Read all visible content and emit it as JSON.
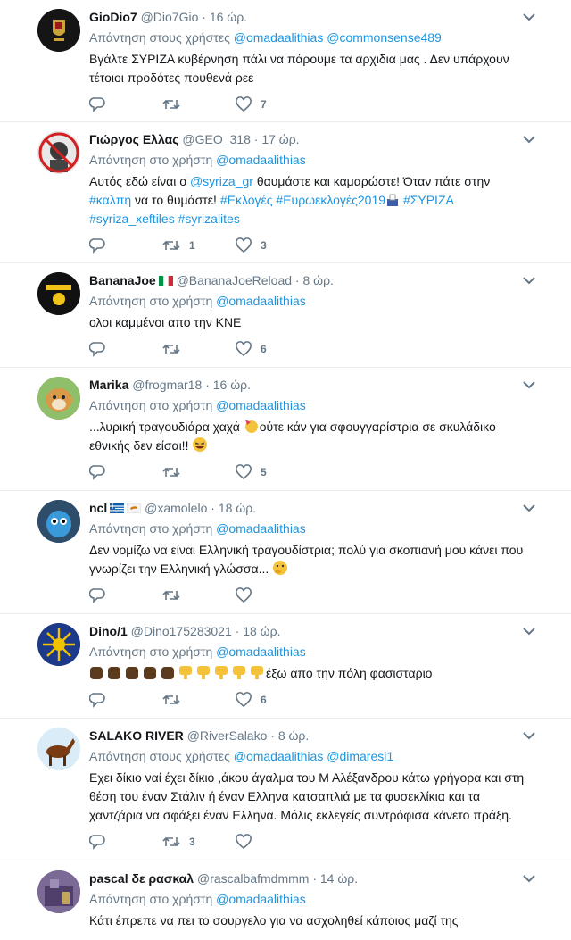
{
  "tweets": [
    {
      "name": "GioDio7",
      "handle": "@Dio7Gio",
      "time": "16 ώρ.",
      "reply_prefix": "Απάντηση στους χρήστες",
      "mentions": [
        "@omadaalithias",
        "@commonsense489"
      ],
      "text": "Βγάλτε ΣΥΡΙΖΑ κυβέρνηση πάλι να πάρουμε τα αρχιδια μας . Δεν υπάρχουν τέτοιοι προδότες πουθενά ρεε",
      "retweets": "",
      "likes": "7"
    },
    {
      "name": "Γιώργος Ελλας",
      "handle": "@GEO_318",
      "time": "17 ώρ.",
      "reply_prefix": "Απάντηση στο χρήστη",
      "mentions": [
        "@omadaalithias"
      ],
      "text_parts": [
        "Αυτός εδώ είναι ο ",
        "@syriza_gr",
        " θαυμάστε και καμαρώστε! Όταν πάτε στην ",
        "#καλπη",
        " να το θυμάστε! ",
        "#Εκλογές",
        " ",
        "#Ευρωεκλογές2019",
        " ",
        "#ΣΥΡΙΖΑ",
        " ",
        "#syriza_xeftiles",
        " ",
        "#syrizalites"
      ],
      "retweets": "1",
      "likes": "3"
    },
    {
      "name": "BananaJoe",
      "handle": "@BananaJoeReload",
      "time": "8 ώρ.",
      "reply_prefix": "Απάντηση στο χρήστη",
      "mentions": [
        "@omadaalithias"
      ],
      "text": "ολοι καμμένοι απο την ΚΝΕ",
      "retweets": "",
      "likes": "6"
    },
    {
      "name": "Marika",
      "handle": "@frogmar18",
      "time": "16 ώρ.",
      "reply_prefix": "Απάντηση στο χρήστη",
      "mentions": [
        "@omadaalithias"
      ],
      "text_a": "...λυρική τραγουδιάρα χαχά ",
      "text_b": "ούτε κάν για σφουγγαρίστρια σε σκυλάδικο εθνικής δεν είσαι!! ",
      "retweets": "",
      "likes": "5"
    },
    {
      "name": "ncl",
      "handle": "@xamolelo",
      "time": "18 ώρ.",
      "reply_prefix": "Απάντηση στο χρήστη",
      "mentions": [
        "@omadaalithias"
      ],
      "text": "Δεν νομίζω να είναι Ελληνική τραγουδίστρια; πολύ για σκοπιανή μου κάνει που γνωρίζει την Ελληνική γλώσσα... ",
      "retweets": "",
      "likes": ""
    },
    {
      "name": "Dino/1",
      "handle": "@Dino175283021",
      "time": "18 ώρ.",
      "reply_prefix": "Απάντηση στο χρήστη",
      "mentions": [
        "@omadaalithias"
      ],
      "text": "έξω απο την πόλη φασισταριο",
      "retweets": "",
      "likes": "6"
    },
    {
      "name": "SALAKO RIVER",
      "handle": "@RiverSalako",
      "time": "8 ώρ.",
      "reply_prefix": "Απάντηση στους χρήστες",
      "mentions": [
        "@omadaalithias",
        "@dimaresi1"
      ],
      "text": "Εχει δίκιο ναί έχει δίκιο ,άκου άγαλμα του Μ Αλέξανδρου κάτω γρήγορα και στη θέση του έναν Στάλιν ή έναν Ελληνα κατσαπλιά με τα φυσεκλίκια και τα χαντζάρια να σφάξει έναν Ελληνα.  Μόλις εκλεγείς συντρόφισα κάνετο πράξη.",
      "retweets": "3",
      "likes": ""
    },
    {
      "name": "pascal δε ρασκαλ",
      "handle": "@rascalbafmdmmm",
      "time": "14 ώρ.",
      "reply_prefix": "Απάντηση στο χρήστη",
      "mentions": [
        "@omadaalithias"
      ],
      "text": "Κάτι έπρεπε να πει το σουργελο για να ασχοληθεί κάποιος μαζί της",
      "retweets": "",
      "likes": ""
    }
  ],
  "separator": "·",
  "colors": {
    "link": "#1b95e0",
    "muted": "#657786",
    "border": "#e6ecf0"
  }
}
